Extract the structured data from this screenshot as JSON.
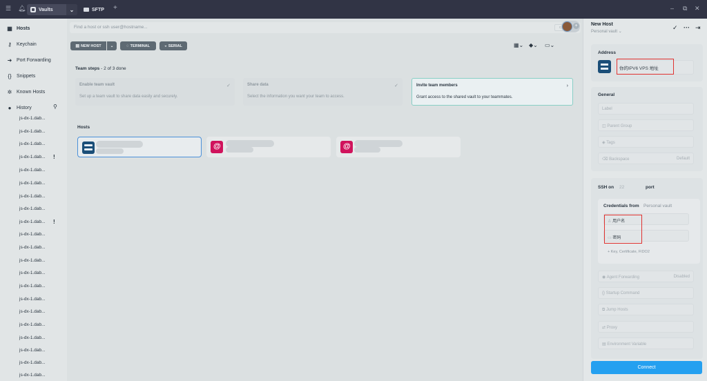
{
  "titlebar": {
    "vault_label": "Vaults",
    "sftp_label": "SFTP",
    "add_tab": "+",
    "minimize": "–",
    "restore": "⧉",
    "close": "✕"
  },
  "sidebar": {
    "items": [
      {
        "label": "Hosts",
        "icon": "hosts-grid-icon"
      },
      {
        "label": "Keychain",
        "icon": "key-icon"
      },
      {
        "label": "Port Forwarding",
        "icon": "arrow-icon"
      },
      {
        "label": "Snippets",
        "icon": "braces-icon"
      },
      {
        "label": "Known Hosts",
        "icon": "gear-icon"
      },
      {
        "label": "History",
        "icon": "clock-icon"
      }
    ],
    "history": [
      "js-dx-1.dab...",
      "js-dx-1.dab...",
      "js-dx-1.dab...",
      "js-dx-1.dab...",
      "js-dx-1.dab...",
      "js-dx-1.dab...",
      "js-dx-1.dab...",
      "js-dx-1.dab...",
      "js-dx-1.dab...",
      "js-dx-1.dab...",
      "js-dx-1.dab...",
      "js-dx-1.dab...",
      "js-dx-1.dab...",
      "js-dx-1.dab...",
      "js-dx-1.dab...",
      "js-dx-1.dab...",
      "js-dx-1.dab...",
      "js-dx-1.dab...",
      "js-dx-1.dab...",
      "js-dx-1.dab...",
      "js-dx-1.dab..."
    ],
    "warn_mark": "!"
  },
  "search": {
    "placeholder": "Find a host or ssh user@hostname...",
    "connect_label": "CONNECT"
  },
  "toolbar": {
    "new_host": "NEW HOST",
    "terminal": "TERMINAL",
    "serial": "SERIAL"
  },
  "steps": {
    "title": "Team steps",
    "progress": " - 2 of 3 done",
    "cards": [
      {
        "title": "Enable team vault",
        "desc": "Set up a team vault to share data easily and securely.",
        "mark": "✓"
      },
      {
        "title": "Share data",
        "desc": "Select the information you want your team to access.",
        "mark": "✓"
      },
      {
        "title": "Invite team members",
        "desc": "Grant access to the shared vault to your teammates.",
        "mark": "›"
      }
    ]
  },
  "hosts": {
    "label": "Hosts"
  },
  "panel": {
    "title": "New Host",
    "subtitle": "Personal vault ⌄",
    "address_label": "Address",
    "address_value": "你的IPV6 VPS 地址",
    "general_label": "General",
    "label_field": "Label",
    "parent_group": "Parent Group",
    "tags": "Tags",
    "backspace": "Backspace",
    "backspace_value": "Default",
    "ssh_on": "SSH on",
    "port_value": "22",
    "port_label": "port",
    "credentials_from": "Credentials from",
    "credentials_vault": "Personal vault",
    "username": "用户名",
    "password": "密码",
    "add_key": "Key, Certificate, FIDO2",
    "agent_forwarding": "Agent Forwarding",
    "agent_value": "Disabled",
    "startup_command": "Startup Command",
    "jump_hosts": "Jump Hosts",
    "proxy": "Proxy",
    "env_variable": "Environment Variable",
    "connect": "Connect"
  }
}
